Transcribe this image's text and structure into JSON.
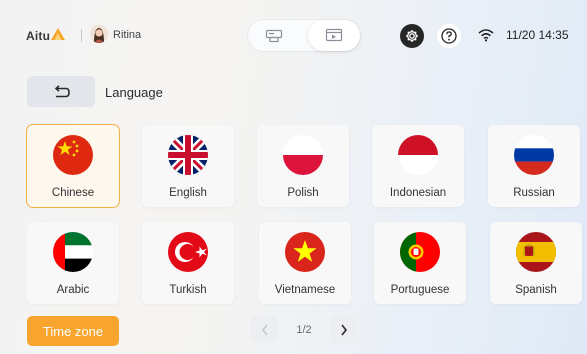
{
  "header": {
    "brand": "Aitu",
    "user_name": "Ritina",
    "clock": "11/20 14:35",
    "icons": [
      "brand-logo-icon",
      "avatar",
      "print-mode-icon",
      "preview-mode-icon",
      "gear-icon",
      "help-icon",
      "wifi-icon"
    ]
  },
  "page": {
    "title": "Language",
    "back_icon": "return-arrow-icon"
  },
  "languages": [
    {
      "label": "Chinese",
      "flag": "china-flag-icon",
      "selected": true
    },
    {
      "label": "English",
      "flag": "uk-flag-icon",
      "selected": false
    },
    {
      "label": "Polish",
      "flag": "poland-flag-icon",
      "selected": false
    },
    {
      "label": "Indonesian",
      "flag": "indonesia-flag-icon",
      "selected": false
    },
    {
      "label": "Russian",
      "flag": "russia-flag-icon",
      "selected": false
    },
    {
      "label": "Arabic",
      "flag": "uae-flag-icon",
      "selected": false
    },
    {
      "label": "Turkish",
      "flag": "turkey-flag-icon",
      "selected": false
    },
    {
      "label": "Vietnamese",
      "flag": "vietnam-flag-icon",
      "selected": false
    },
    {
      "label": "Portuguese",
      "flag": "portugal-flag-icon",
      "selected": false
    },
    {
      "label": "Spanish",
      "flag": "spain-flag-icon",
      "selected": false
    }
  ],
  "footer": {
    "time_zone_label": "Time zone",
    "pagination": "1/2"
  },
  "colors": {
    "accent": "#f7a52f",
    "selected_border": "#f4ae49",
    "selected_bg": "#fdf7ee",
    "tile_bg": "#f8f8f9"
  }
}
